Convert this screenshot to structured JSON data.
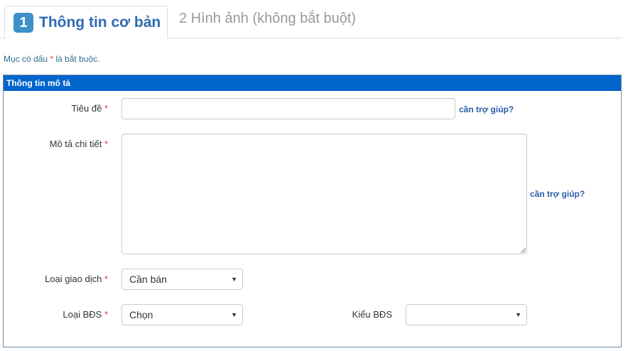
{
  "tabs": [
    {
      "number": "1",
      "label": "Thông tin cơ bản"
    },
    {
      "label": "2 Hình ảnh (không bắt buột)"
    }
  ],
  "required_note": {
    "prefix": "Mục có dấu ",
    "star": "*",
    "suffix": " là bắt buộc."
  },
  "panel": {
    "title": "Thông tin mô tả",
    "required_star": "*",
    "fields": {
      "title": {
        "label": "Tiêu đề",
        "value": "",
        "help": "cần trợ giúp?"
      },
      "description": {
        "label": "Mô tả chi tiết",
        "value": "",
        "help": "cần trợ giúp?"
      },
      "transaction_type": {
        "label": "Loại giao dịch",
        "selected": "Cần bán"
      },
      "property_type": {
        "label": "Loại BĐS",
        "selected": "Chọn"
      },
      "property_style": {
        "label": "Kiểu BĐS",
        "selected": ""
      }
    }
  },
  "icons": {
    "select_arrow": "caret-down-icon"
  },
  "colors": {
    "panel_header": "#0066cc",
    "tab_active": "#2f6ab3",
    "required": "#e03c31",
    "help_link": "#2a5ca8"
  }
}
